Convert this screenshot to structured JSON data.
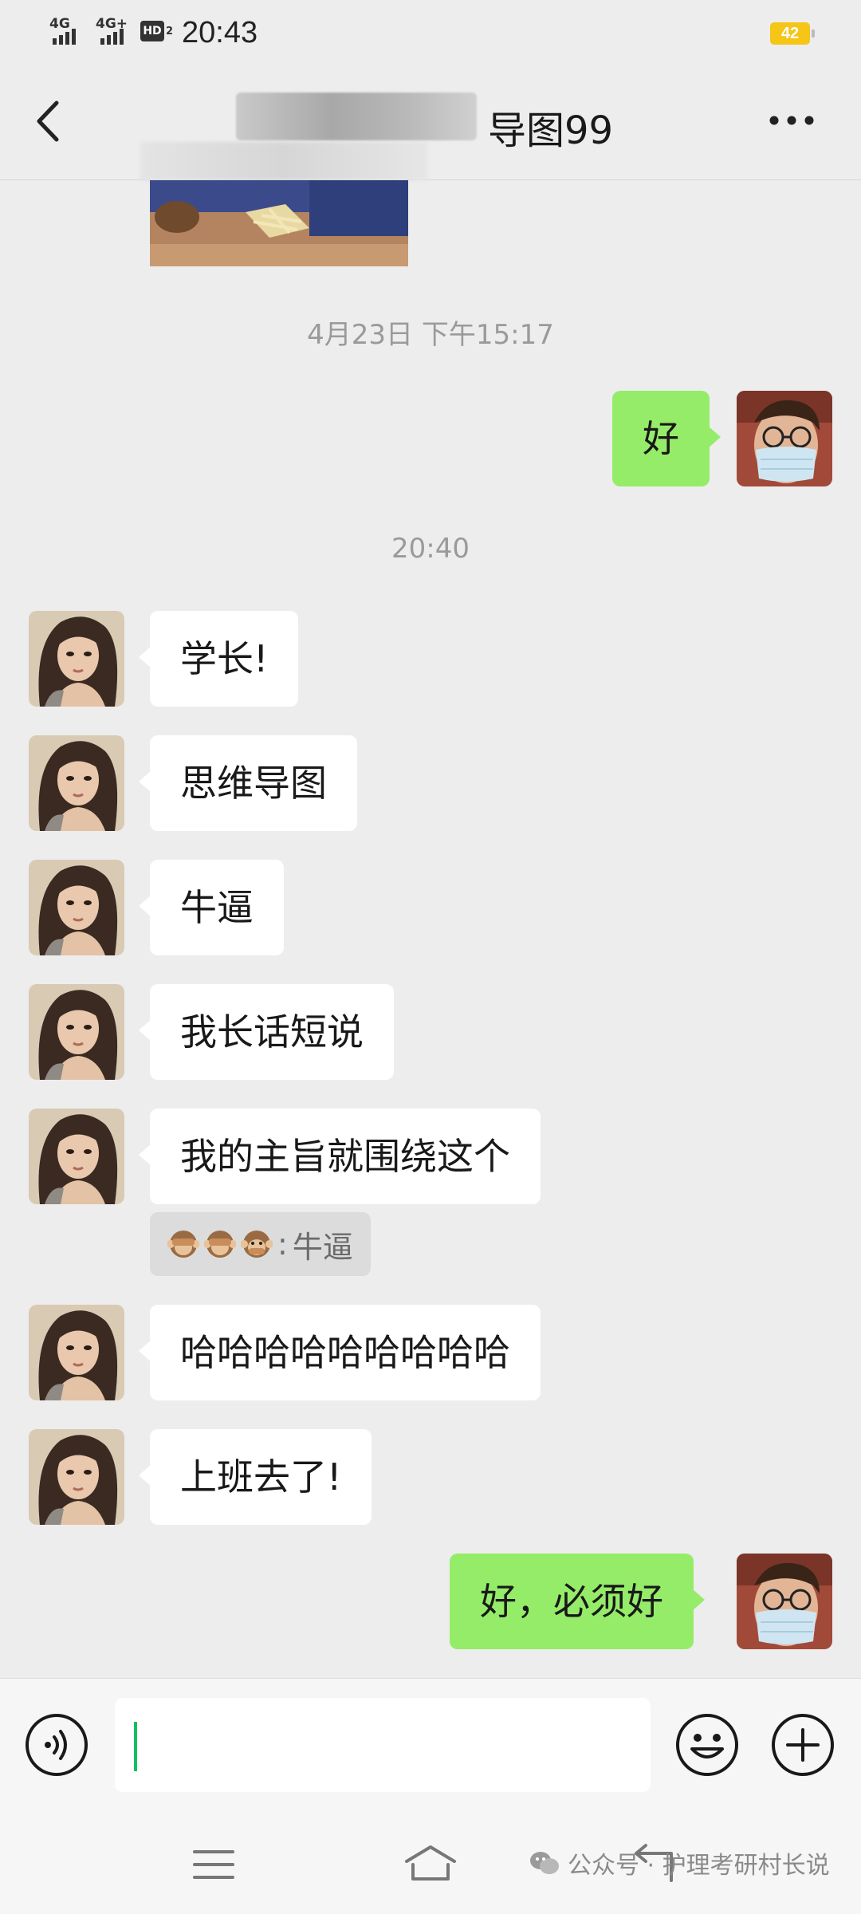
{
  "status_bar": {
    "signal1": "4G",
    "signal2": "4G+",
    "hd": "HD",
    "hd_sub": "2",
    "time": "20:43",
    "battery": "42"
  },
  "nav": {
    "title": "导图99",
    "back_icon": "chevron-left-icon",
    "more_icon": "ellipsis-icon"
  },
  "timestamps": [
    "4月23日 下午15:17",
    "20:40"
  ],
  "messages": [
    {
      "side": "right",
      "text": "好"
    },
    {
      "side": "left",
      "text": "学长!"
    },
    {
      "side": "left",
      "text": "思维导图"
    },
    {
      "side": "left",
      "text": "牛逼"
    },
    {
      "side": "left",
      "text": "我长话短说"
    },
    {
      "side": "left",
      "text": "我的主旨就围绕这个"
    },
    {
      "side": "left",
      "text": "哈哈哈哈哈哈哈哈哈"
    },
    {
      "side": "left",
      "text": "上班去了!"
    },
    {
      "side": "right",
      "text": "好，必须好"
    }
  ],
  "quote": {
    "emojis": [
      "see-no-evil-monkey",
      "see-no-evil-monkey",
      "speak-no-evil-monkey"
    ],
    "separator": ":",
    "text": "牛逼"
  },
  "input_bar": {
    "voice_icon": "voice-icon",
    "input_value": "",
    "emoji_icon": "emoji-icon",
    "plus_icon": "plus-icon"
  },
  "sys_nav": {
    "menu_icon": "menu-icon",
    "home_icon": "home-icon",
    "back_icon": "back-icon"
  },
  "watermark": {
    "text": "公众号 · 护理考研村长说"
  },
  "colors": {
    "background": "#EDEDED",
    "bubble_self": "#95EC69",
    "bubble_other": "#FFFFFF",
    "accent": "#07C160",
    "battery": "#F5C518"
  }
}
